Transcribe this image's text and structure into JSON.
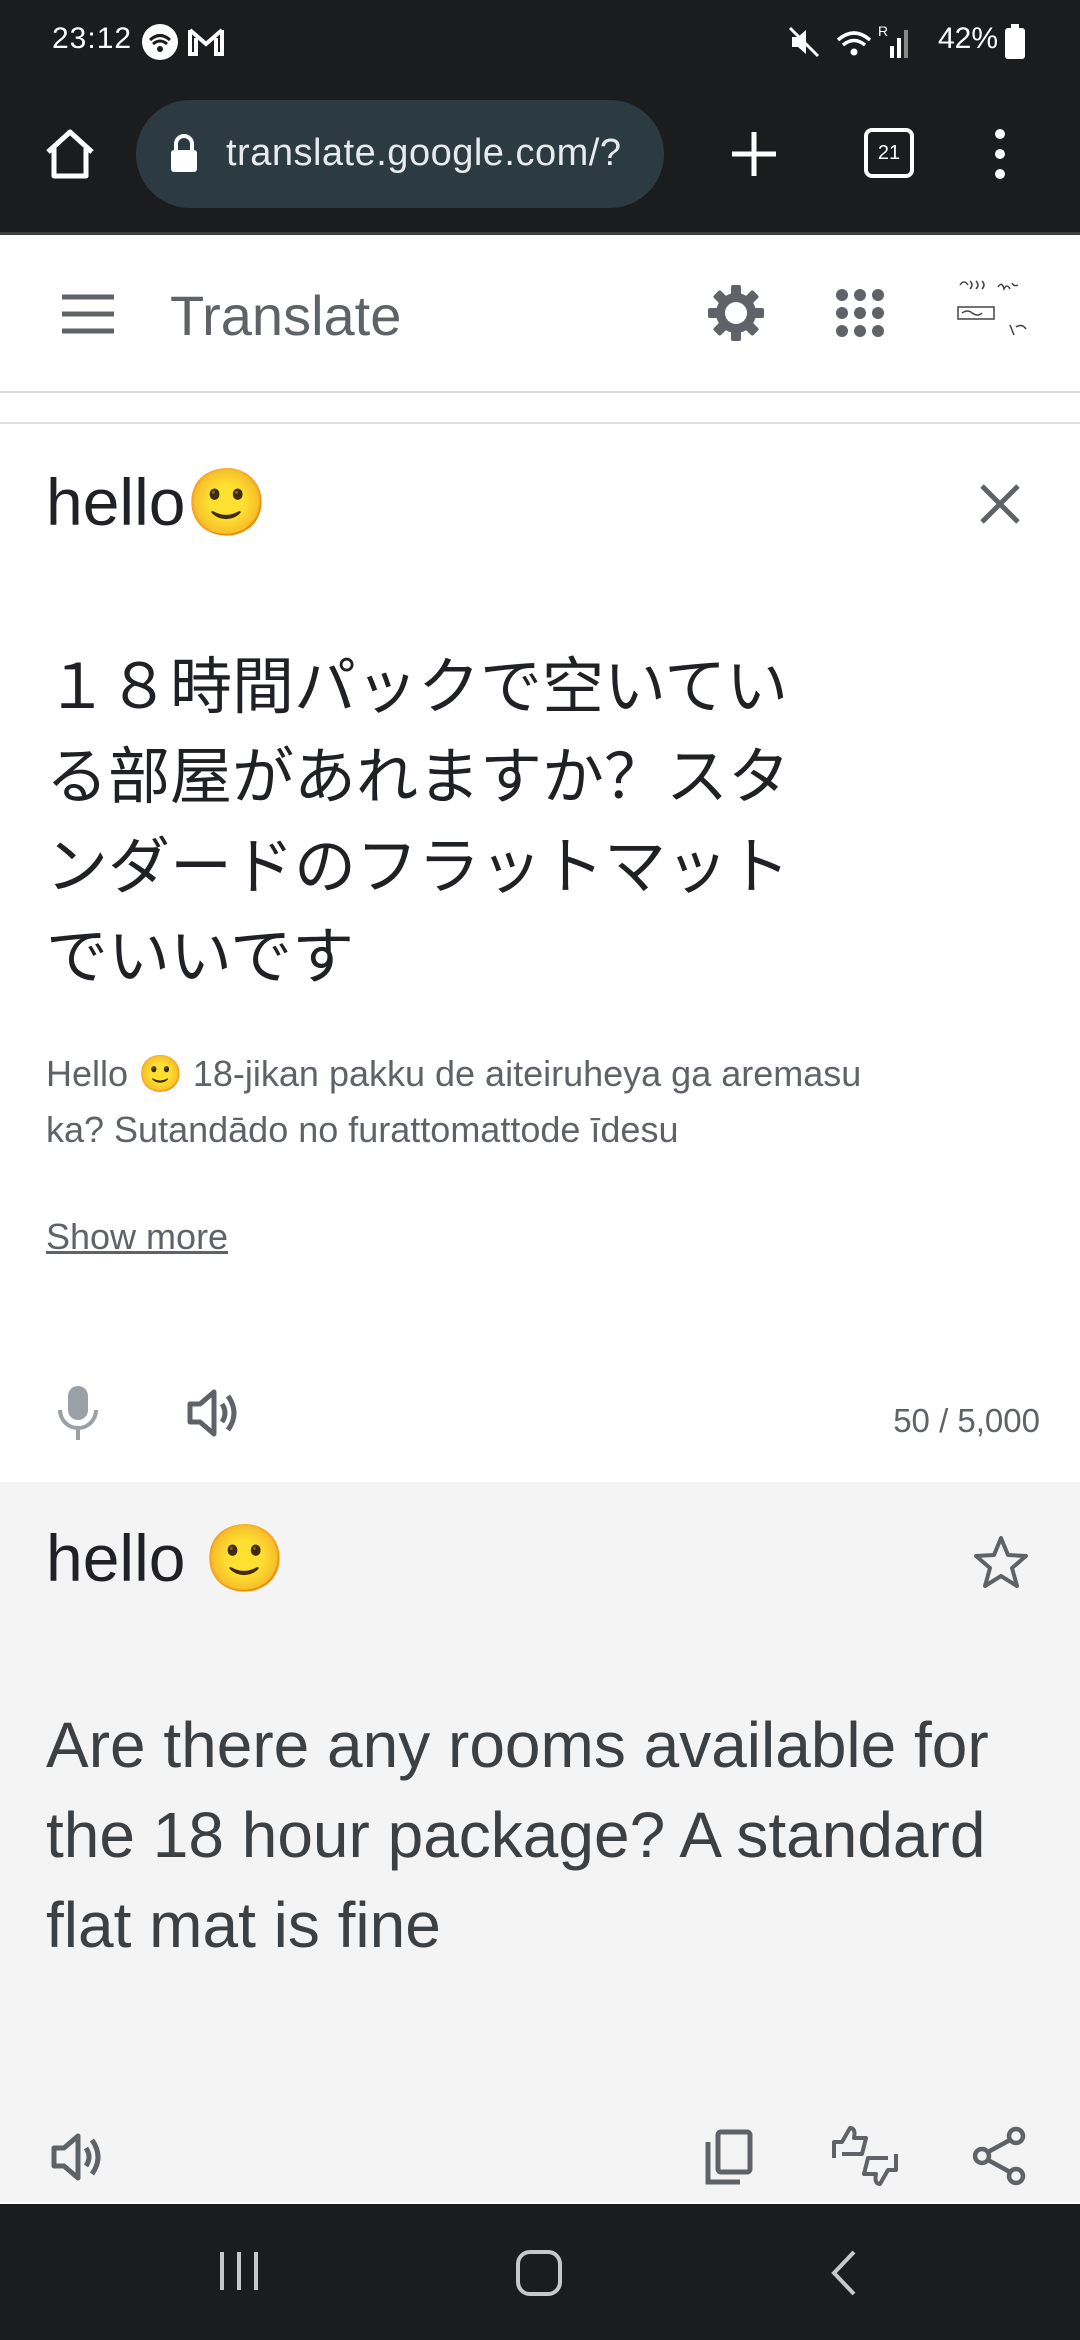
{
  "status_bar": {
    "time": "23:12",
    "battery_percent": "42%",
    "icons": [
      "wifi-icon",
      "gmail-icon",
      "mute-icon",
      "signal-icon",
      "battery-icon"
    ]
  },
  "browser": {
    "url": "translate.google.com/?",
    "tab_count": "21"
  },
  "app": {
    "title": "Translate"
  },
  "source": {
    "first_line": "hello🙂",
    "japanese": "１８時間パックで空いている部屋があれますか？スタンダードのフラットマットでいいです",
    "romaji": "Hello 🙂 18-jikan pakku de aiteiruheya ga aremasu ka? Sutandādo no furattomattode īdesu",
    "show_more": "Show more",
    "char_count": "50 / 5,000"
  },
  "target": {
    "first_line": "hello 🙂",
    "text": "Are there any rooms available for the 18 hour package? A standard flat mat is fine"
  },
  "colors": {
    "status_bg": "#1a1c1e",
    "url_pill": "#2c3a42",
    "target_bg": "#f4f4f4",
    "icon_gray": "#5f6368"
  }
}
